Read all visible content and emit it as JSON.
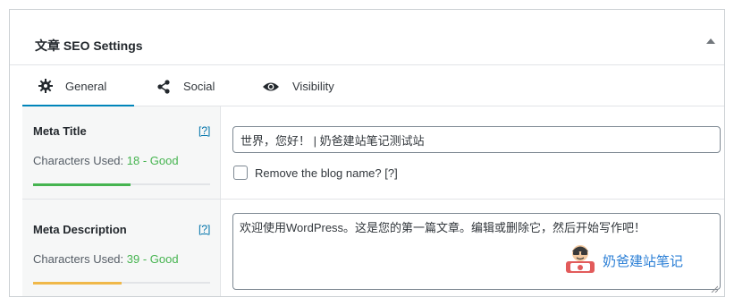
{
  "panel": {
    "title": "文章 SEO Settings"
  },
  "tabs": [
    {
      "label": "General",
      "icon": "gear-icon",
      "active": true
    },
    {
      "label": "Social",
      "icon": "share-icon",
      "active": false
    },
    {
      "label": "Visibility",
      "icon": "eye-icon",
      "active": false
    }
  ],
  "meta_title": {
    "label": "Meta Title",
    "help": "[?]",
    "chars_prefix": "Characters Used: ",
    "chars_status": "18 - Good",
    "value": "世界，您好！ | 奶爸建站笔记测试站",
    "meter_color": "#46b450",
    "meter_fraction": 0.55,
    "checkbox_label": "Remove the blog name? [?]"
  },
  "meta_description": {
    "label": "Meta Description",
    "help": "[?]",
    "chars_prefix": "Characters Used: ",
    "chars_status": "39 - Good",
    "value": "欢迎使用WordPress。这是您的第一篇文章。编辑或删除它，然后开始写作吧！",
    "meter_color": "#f0b849",
    "meter_fraction": 0.5
  },
  "watermark": {
    "text": "奶爸建站笔记"
  },
  "colors": {
    "accent": "#0085ba",
    "good": "#46b450",
    "link": "#0073aa"
  }
}
